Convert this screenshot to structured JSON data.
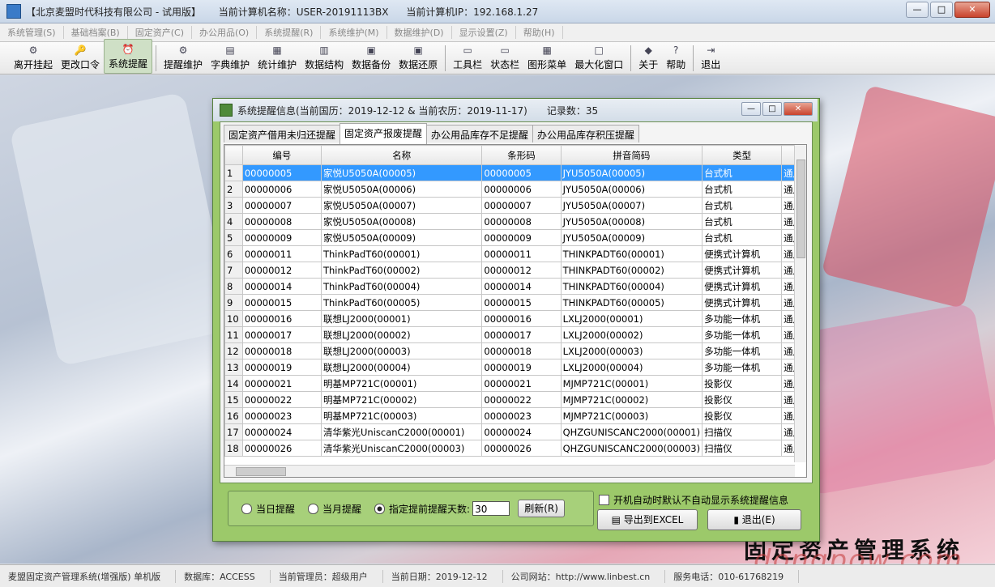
{
  "window": {
    "title_parts": [
      "【北京麦盟时代科技有限公司 - 试用版】",
      "当前计算机名称：USER-20191113BX",
      "当前计算机IP：192.168.1.27"
    ],
    "min": "—",
    "max": "□",
    "close": "✕"
  },
  "menu": [
    "系统管理(S)",
    "基础档案(B)",
    "固定资产(C)",
    "办公用品(O)",
    "系统提醒(R)",
    "系统维护(M)",
    "数据维护(D)",
    "显示设置(Z)",
    "帮助(H)"
  ],
  "toolbar": [
    {
      "label": "离开挂起",
      "icon": "⚙"
    },
    {
      "label": "更改口令",
      "icon": "🔑"
    },
    {
      "label": "系统提醒",
      "icon": "⏰"
    },
    {
      "label": "提醒维护",
      "icon": "⚙"
    },
    {
      "label": "字典维护",
      "icon": "▤"
    },
    {
      "label": "统计维护",
      "icon": "▦"
    },
    {
      "label": "数据结构",
      "icon": "▥"
    },
    {
      "label": "数据备份",
      "icon": "▣"
    },
    {
      "label": "数据还原",
      "icon": "▣"
    },
    {
      "label": "工具栏",
      "icon": "▭"
    },
    {
      "label": "状态栏",
      "icon": "▭"
    },
    {
      "label": "图形菜单",
      "icon": "▦"
    },
    {
      "label": "最大化窗口",
      "icon": "□"
    },
    {
      "label": "关于",
      "icon": "◆"
    },
    {
      "label": "帮助",
      "icon": "?"
    },
    {
      "label": "退出",
      "icon": "⇥"
    }
  ],
  "dialog": {
    "title": "系统提醒信息(当前国历：2019-12-12 & 当前农历：2019-11-17)　　记录数：35",
    "tabs": [
      "固定资产借用未归还提醒",
      "固定资产报废提醒",
      "办公用品库存不足提醒",
      "办公用品库存积压提醒"
    ],
    "active_tab": 1,
    "columns": [
      "编号",
      "名称",
      "条形码",
      "拼音简码",
      "类型",
      ""
    ],
    "rows": [
      [
        "1",
        "00000005",
        "家悦U5050A(00005)",
        "00000005",
        "JYU5050A(00005)",
        "台式机",
        "通用"
      ],
      [
        "2",
        "00000006",
        "家悦U5050A(00006)",
        "00000006",
        "JYU5050A(00006)",
        "台式机",
        "通用"
      ],
      [
        "3",
        "00000007",
        "家悦U5050A(00007)",
        "00000007",
        "JYU5050A(00007)",
        "台式机",
        "通用"
      ],
      [
        "4",
        "00000008",
        "家悦U5050A(00008)",
        "00000008",
        "JYU5050A(00008)",
        "台式机",
        "通用"
      ],
      [
        "5",
        "00000009",
        "家悦U5050A(00009)",
        "00000009",
        "JYU5050A(00009)",
        "台式机",
        "通用"
      ],
      [
        "6",
        "00000011",
        "ThinkPadT60(00001)",
        "00000011",
        "THINKPADT60(00001)",
        "便携式计算机",
        "通用"
      ],
      [
        "7",
        "00000012",
        "ThinkPadT60(00002)",
        "00000012",
        "THINKPADT60(00002)",
        "便携式计算机",
        "通用"
      ],
      [
        "8",
        "00000014",
        "ThinkPadT60(00004)",
        "00000014",
        "THINKPADT60(00004)",
        "便携式计算机",
        "通用"
      ],
      [
        "9",
        "00000015",
        "ThinkPadT60(00005)",
        "00000015",
        "THINKPADT60(00005)",
        "便携式计算机",
        "通用"
      ],
      [
        "10",
        "00000016",
        "联想LJ2000(00001)",
        "00000016",
        "LXLJ2000(00001)",
        "多功能一体机",
        "通用"
      ],
      [
        "11",
        "00000017",
        "联想LJ2000(00002)",
        "00000017",
        "LXLJ2000(00002)",
        "多功能一体机",
        "通用"
      ],
      [
        "12",
        "00000018",
        "联想LJ2000(00003)",
        "00000018",
        "LXLJ2000(00003)",
        "多功能一体机",
        "通用"
      ],
      [
        "13",
        "00000019",
        "联想LJ2000(00004)",
        "00000019",
        "LXLJ2000(00004)",
        "多功能一体机",
        "通用"
      ],
      [
        "14",
        "00000021",
        "明基MP721C(00001)",
        "00000021",
        "MJMP721C(00001)",
        "投影仪",
        "通用"
      ],
      [
        "15",
        "00000022",
        "明基MP721C(00002)",
        "00000022",
        "MJMP721C(00002)",
        "投影仪",
        "通用"
      ],
      [
        "16",
        "00000023",
        "明基MP721C(00003)",
        "00000023",
        "MJMP721C(00003)",
        "投影仪",
        "通用"
      ],
      [
        "17",
        "00000024",
        "清华紫光UniscanC2000(00001)",
        "00000024",
        "QHZGUNISCANC2000(00001)",
        "扫描仪",
        "通用"
      ],
      [
        "18",
        "00000026",
        "清华紫光UniscanC2000(00003)",
        "00000026",
        "QHZGUNISCANC2000(00003)",
        "扫描仪",
        "通用"
      ]
    ],
    "selected_row": 0,
    "options": {
      "today": "当日提醒",
      "month": "当月提醒",
      "fixed": "指定提前提醒天数:",
      "days_value": "30",
      "selected": "fixed",
      "refresh": "刷新(R)",
      "checkbox": "开机自动时默认不自动显示系统提醒信息",
      "export": "导出到EXCEL",
      "exit": "退出(E)"
    }
  },
  "background": {
    "brand": "固定资产管理系统",
    "watermark": "dongpow.com"
  },
  "statusbar": [
    "麦盟固定资产管理系统(增强版) 单机版",
    "数据库：ACCESS",
    "当前管理员：超级用户",
    "当前日期：2019-12-12",
    "公司网站：http://www.linbest.cn",
    "服务电话：010-61768219"
  ]
}
